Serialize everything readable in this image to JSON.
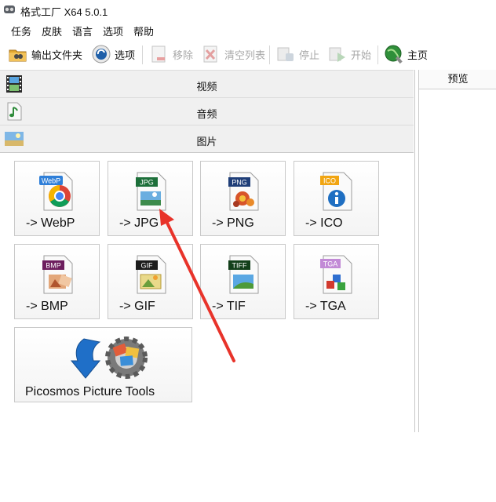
{
  "window": {
    "title": "格式工厂 X64 5.0.1"
  },
  "menu": [
    "任务",
    "皮肤",
    "语言",
    "选项",
    "帮助"
  ],
  "toolbar": {
    "output_folder": "输出文件夹",
    "options": "选项",
    "remove": "移除",
    "clear_list": "清空列表",
    "stop": "停止",
    "start": "开始",
    "home": "主页"
  },
  "categories": [
    "视频",
    "音频",
    "图片"
  ],
  "image_formats": [
    {
      "badge": "WebP",
      "label": "-> WebP",
      "color": "#2f7fd8"
    },
    {
      "badge": "JPG",
      "label": "-> JPG",
      "color": "#1d6f3a"
    },
    {
      "badge": "PNG",
      "label": "-> PNG",
      "color": "#1f3e78"
    },
    {
      "badge": "ICO",
      "label": "-> ICO",
      "color": "#f1a512"
    },
    {
      "badge": "BMP",
      "label": "-> BMP",
      "color": "#6d1e5e"
    },
    {
      "badge": "GIF",
      "label": "-> GIF",
      "color": "#1c1c1c"
    },
    {
      "badge": "TIFF",
      "label": "-> TIF",
      "color": "#123f1a"
    },
    {
      "badge": "TGA",
      "label": "-> TGA",
      "color": "#c28ad6"
    }
  ],
  "tools": {
    "label": "Picosmos Picture Tools"
  },
  "preview": {
    "header": "预览"
  },
  "annotation": {
    "arrow_color": "#e8332a"
  }
}
